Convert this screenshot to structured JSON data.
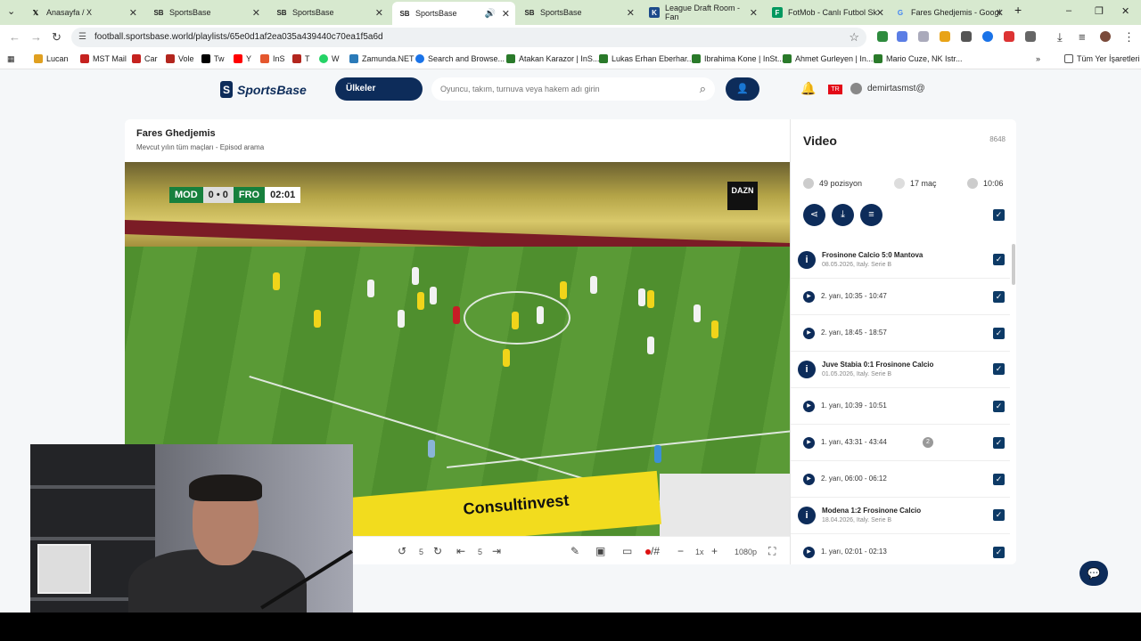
{
  "browser": {
    "tabs": [
      {
        "title": "Anasayfa / X",
        "icon": "x-logo"
      },
      {
        "title": "SportsBase",
        "icon": "sb-logo"
      },
      {
        "title": "SportsBase",
        "icon": "sb-logo"
      },
      {
        "title": "SportsBase",
        "icon": "sb-logo",
        "active": true,
        "audio": true
      },
      {
        "title": "SportsBase",
        "icon": "sb-logo"
      },
      {
        "title": "League Draft Room - Fan",
        "icon": "k-logo"
      },
      {
        "title": "FotMob - Canlı Futbol Sk",
        "icon": "fotmob-logo"
      },
      {
        "title": "Fares Ghedjemis - Googl",
        "icon": "google-logo"
      }
    ],
    "url": "football.sportsbase.world/playlists/65e0d1af2ea035a439440c70ea1f5a6d",
    "bookmarks": [
      {
        "label": "Lucan",
        "color": "#e0a020"
      },
      {
        "label": "MST Mail",
        "color": "#c5221f"
      },
      {
        "label": "Car",
        "color": "#c5221f"
      },
      {
        "label": "Vole",
        "color": "#b3261e"
      },
      {
        "label": "Tw",
        "color": "#000000"
      },
      {
        "label": "Y",
        "color": "#ff0000"
      },
      {
        "label": "InS",
        "color": "#e4572e"
      },
      {
        "label": "T",
        "color": "#b3261e"
      },
      {
        "label": "W",
        "color": "#25d366"
      },
      {
        "label": "Zamunda.NET",
        "color": "#2a7ab8"
      },
      {
        "label": "Search and Browse...",
        "color": "#1a73e8"
      },
      {
        "label": "Atakan Karazor | InS...",
        "color": "#2a7a2a"
      },
      {
        "label": "Lukas Erhan Eberhar...",
        "color": "#2a7a2a"
      },
      {
        "label": "Ibrahima Kone | InSt...",
        "color": "#2a7a2a"
      },
      {
        "label": "Ahmet Gurleyen | In...",
        "color": "#2a7a2a"
      },
      {
        "label": "Mario Cuze, NK Istr...",
        "color": "#2a7a2a"
      }
    ],
    "all_bookmarks": "Tüm Yer İşaretleri"
  },
  "site": {
    "logo_text": "SportsBase",
    "logo_mark": "S",
    "countries_button": "Ülkeler",
    "search_placeholder": "Oyuncu, takım, turnuva veya hakem adı girin",
    "user": "demirtasmst@",
    "flag": "TR"
  },
  "playlist": {
    "title": "Fares Ghedjemis",
    "subtitle": "Mevcut yılın tüm maçları - Episod arama"
  },
  "video": {
    "scorebug": {
      "home": "MOD",
      "score": "0 • 0",
      "away": "FRO",
      "time": "02:01"
    },
    "broadcaster": "DAZN",
    "sponsor": "Consultinvest",
    "controls": {
      "rewind_seconds": "5",
      "forward_seconds": "5",
      "speed": "1x",
      "quality": "1080p",
      "draw_label": "/#"
    }
  },
  "panel": {
    "title": "Video",
    "count": "8648",
    "stats": {
      "positions": "49 pozisyon",
      "matches": "17 maç",
      "duration": "10:06"
    },
    "items": [
      {
        "type": "match",
        "title": "Frosinone Calcio 5:0 Mantova",
        "sub": "08.05.2026, Italy. Serie B"
      },
      {
        "type": "clip",
        "text": "2. yarı, 10:35 - 10:47"
      },
      {
        "type": "clip",
        "text": "2. yarı, 18:45 - 18:57"
      },
      {
        "type": "match",
        "title": "Juve Stabia 0:1 Frosinone Calcio",
        "sub": "01.05.2026, Italy. Serie B"
      },
      {
        "type": "clip",
        "text": "1. yarı, 10:39 - 10:51"
      },
      {
        "type": "clip",
        "text": "1. yarı, 43:31 - 43:44",
        "badge": "2"
      },
      {
        "type": "clip",
        "text": "2. yarı, 06:00 - 06:12"
      },
      {
        "type": "match",
        "title": "Modena 1:2 Frosinone Calcio",
        "sub": "18.04.2026, Italy. Serie B"
      },
      {
        "type": "clip",
        "text": "1. yarı, 02:01 - 02:13"
      }
    ]
  },
  "colors": {
    "brand": "#0d2c5a",
    "checkbox": "#0d3a66",
    "tabstrip": "#d7e9cf"
  }
}
